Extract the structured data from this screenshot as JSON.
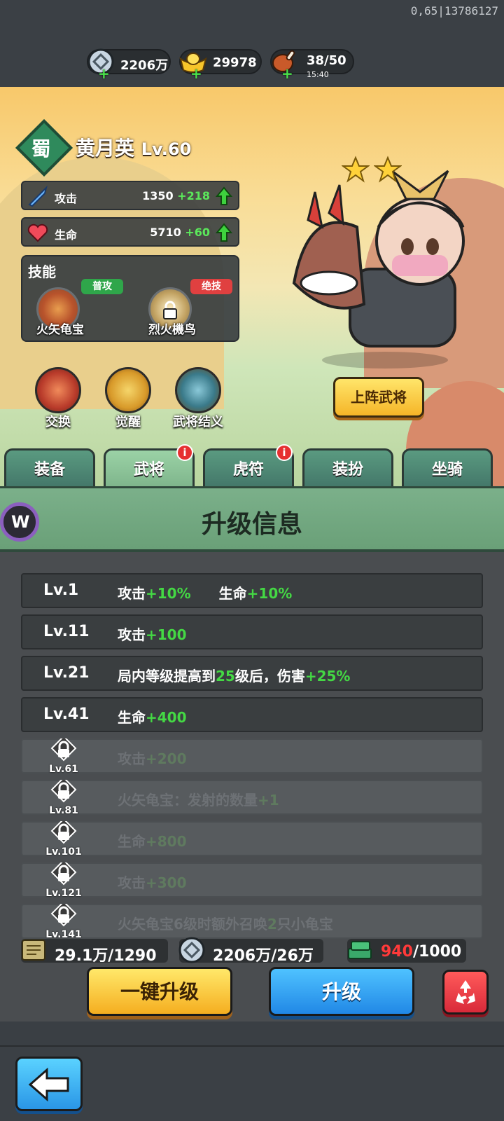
{
  "debug_text": "0,65|13786127",
  "resources": {
    "coins": {
      "value": "2206万",
      "icon": "coin-icon"
    },
    "gold": {
      "value": "29978",
      "icon": "gold-ingot-icon"
    },
    "stamina": {
      "value": "38/50",
      "timer": "15:40",
      "icon": "meat-icon"
    }
  },
  "hero": {
    "faction": "蜀",
    "name": "黄月英",
    "level": "Lv.60",
    "stars": 2,
    "attack": {
      "label": "攻击",
      "value": "1350",
      "bonus": "+218"
    },
    "hp": {
      "label": "生命",
      "value": "5710",
      "bonus": "+60"
    },
    "skills_title": "技能",
    "skills": [
      {
        "tag": "普攻",
        "name": "火矢龟宝",
        "locked": false
      },
      {
        "tag": "绝技",
        "name": "烈火機鸟",
        "locked": true
      }
    ],
    "actions": [
      {
        "label": "交换"
      },
      {
        "label": "觉醒"
      },
      {
        "label": "武将结义"
      }
    ],
    "deploy_label": "上阵武将"
  },
  "tabs": [
    {
      "label": "装备",
      "badge": ""
    },
    {
      "label": "武将",
      "badge": "i"
    },
    {
      "label": "虎符",
      "badge": "i"
    },
    {
      "label": "装扮",
      "badge": ""
    },
    {
      "label": "坐骑",
      "badge": ""
    }
  ],
  "panel": {
    "title": "升级信息",
    "logo_letter": "W",
    "rows": [
      {
        "lv": "Lv.1",
        "parts": [
          "攻击",
          "+10%",
          "　　生命",
          "+10%"
        ],
        "locked": false
      },
      {
        "lv": "Lv.11",
        "parts": [
          "攻击",
          "+100"
        ],
        "locked": false
      },
      {
        "lv": "Lv.21",
        "parts": [
          "局内等级提高到",
          "25",
          "级后，伤害",
          "+25%"
        ],
        "locked": false
      },
      {
        "lv": "Lv.41",
        "parts": [
          "生命",
          "+400"
        ],
        "locked": false
      },
      {
        "lv": "Lv.61",
        "parts": [
          "攻击",
          "+200"
        ],
        "locked": true
      },
      {
        "lv": "Lv.81",
        "parts": [
          "火矢龟宝：发射的数量",
          "+1"
        ],
        "locked": true
      },
      {
        "lv": "Lv.101",
        "parts": [
          "生命",
          "+800"
        ],
        "locked": true
      },
      {
        "lv": "Lv.121",
        "parts": [
          "攻击",
          "+300"
        ],
        "locked": true
      },
      {
        "lv": "Lv.141",
        "parts": [
          "火矢龟宝6级时额外召唤",
          "2",
          "只小龟宝"
        ],
        "locked": true
      }
    ]
  },
  "costs": {
    "scroll": {
      "value": "29.1万/1290"
    },
    "coin": {
      "value": "2206万/26万"
    },
    "jade": {
      "have": "940",
      "need": "/1000"
    }
  },
  "buttons": {
    "one_key": "一键升级",
    "upgrade": "升级"
  }
}
